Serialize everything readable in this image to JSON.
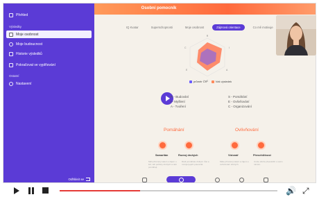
{
  "sidebar": {
    "items": [
      {
        "label": "Přehled"
      },
      {
        "label": "Moje osobnost"
      },
      {
        "label": "Moje budoucnost"
      },
      {
        "label": "Historie výsledků"
      },
      {
        "label": "Pokračovat ve vyplňování"
      },
      {
        "label": "Nastavení"
      }
    ],
    "section_results": "Výsledky",
    "section_other": "Ostatní",
    "logout": "Odhlásit se"
  },
  "header": {
    "title": "Osobní pomocník"
  },
  "tabs": [
    {
      "label": "IQ Kvatar"
    },
    {
      "label": "Superschopnosti"
    },
    {
      "label": "Moje osobnost"
    },
    {
      "label": "Zájmová orientace"
    },
    {
      "label": "Co mě motivuje"
    }
  ],
  "radar": {
    "axis_labels": [
      "R",
      "I",
      "A",
      "S",
      "E",
      "C"
    ],
    "legend": [
      {
        "label": "průměr ČR",
        "color": "#6a5cff"
      },
      {
        "label": "Váš výsledek",
        "color": "#ff8a5b"
      }
    ]
  },
  "types": {
    "left": [
      "R - Budování",
      "I - Myšlení",
      "A - Tvoření"
    ],
    "right": [
      "S - Pomáhání",
      "E - Ovlivňování",
      "C - Organizování"
    ]
  },
  "sections": [
    {
      "title": "Pomáhání",
      "badges": [
        {
          "label": "Samaritán",
          "text": "Měli přirozený talent a zájem o lidi; vidí potřeby druhých a rádi pomáhají."
        },
        {
          "label": "Rozvoj druhých",
          "text": "Rádi pomáháte druhým růst a rozvíjet jejich potenciál."
        }
      ]
    },
    {
      "title": "Ovlivňování",
      "badges": [
        {
          "label": "Vizionář",
          "text": "Máte přirozený talent a zájem o ovlivňování druhých."
        },
        {
          "label": "Přesvědčivost",
          "text": "Umíte druhé přesvědčit o svém názoru."
        }
      ]
    }
  ],
  "player": {
    "progress": 0.37,
    "volume_icon": "volume-icon",
    "fullscreen_icon": "fullscreen-icon"
  },
  "colors": {
    "accent": "#5b3bd6",
    "orange": "#ff6a3d",
    "progress": "#e53935"
  }
}
